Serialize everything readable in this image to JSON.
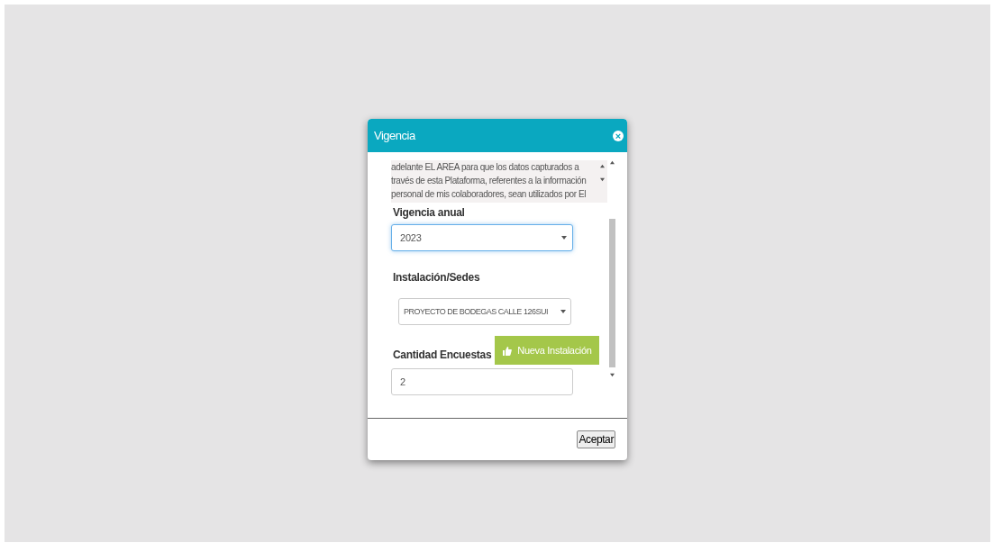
{
  "dialog": {
    "title": "Vigencia",
    "close": "×",
    "terms_lines": [
      "adelante EL AREA para que los datos capturados a",
      "través de esta Plataforma, referentes a la información",
      "personal de mis colaboradores, sean utilizados por El"
    ],
    "fields": [
      {
        "kind": "select",
        "label": "Vigencia anual",
        "value": "2023",
        "focused": true
      },
      {
        "kind": "select",
        "label": "Instalación/Sedes",
        "value": "PROYECTO DE BODEGAS CALLE 126SUI",
        "focused": false
      },
      {
        "kind": "input",
        "label": "Cantidad Encuestas",
        "button": "Nueva Instalación",
        "value": "2",
        "focused": false
      }
    ],
    "accept": "Aceptar"
  }
}
